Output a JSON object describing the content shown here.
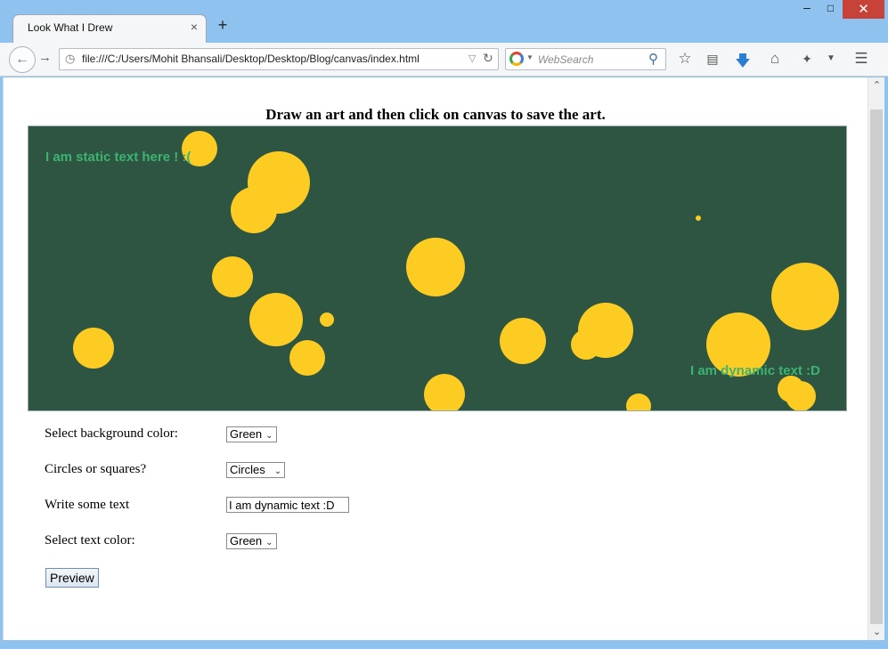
{
  "browser": {
    "tab_title": "Look What I Drew",
    "tab_close": "×",
    "new_tab": "+",
    "url": "file:///C:/Users/Mohit Bhansali/Desktop/Desktop/Blog/canvas/index.html",
    "search_placeholder": "WebSearch",
    "window_controls": {
      "minimize": "–",
      "maximize": "□",
      "close": "✕"
    },
    "icons": [
      "back-arrow-icon",
      "forward-arrow-icon",
      "globe-icon",
      "reload-icon",
      "search-icon",
      "bookmark-star-icon",
      "reading-list-icon",
      "download-icon",
      "home-icon",
      "extension-icon",
      "menu-icon"
    ]
  },
  "page": {
    "heading": "Draw an art and then click on canvas to save the art.",
    "canvas": {
      "background": "#2d5541",
      "shape_color": "#fccc23",
      "static_text": "I am static text here ! :(",
      "dynamic_text": "I am dynamic text :D",
      "text_color": "#3cb371"
    },
    "form": {
      "bg_label": "Select background color:",
      "bg_value": "Green",
      "shape_label": "Circles or squares?",
      "shape_value": "Circles",
      "text_label": "Write some text",
      "text_value": "I am dynamic text :D",
      "text_color_label": "Select text color:",
      "text_color_value": "Green",
      "preview_label": "Preview"
    }
  }
}
